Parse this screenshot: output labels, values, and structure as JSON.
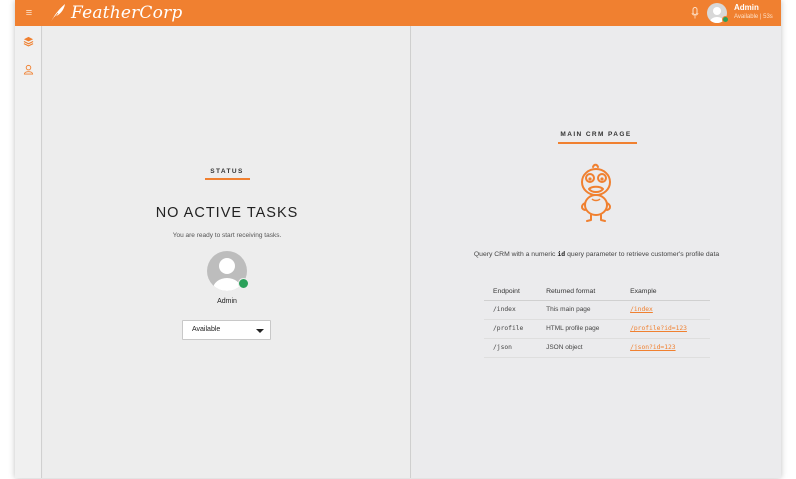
{
  "app": {
    "brand": "FeatherCorp",
    "accent_color": "#f08030",
    "menu_icon": "hamburger-icon",
    "mic_icon": "microphone-icon"
  },
  "user": {
    "name": "Admin",
    "status": "Available | 53s",
    "status_color": "#2aa05a"
  },
  "sidebar": {
    "items": [
      {
        "icon": "layers-icon"
      },
      {
        "icon": "user-icon"
      }
    ]
  },
  "status_panel": {
    "label": "STATUS",
    "title": "NO ACTIVE TASKS",
    "subtitle": "You are ready to start receiving tasks.",
    "agent_name": "Admin",
    "select_value": "Available"
  },
  "crm_panel": {
    "label": "MAIN CRM PAGE",
    "mascot_icon": "duck-mascot-icon",
    "description_before": "Query CRM with a numeric ",
    "description_code": "id",
    "description_after": " query parameter to retrieve customer's profile data",
    "table": {
      "headers": [
        "Endpoint",
        "Returned format",
        "Example"
      ],
      "rows": [
        {
          "endpoint": "/index",
          "format": "This main page",
          "example": "/index"
        },
        {
          "endpoint": "/profile",
          "format": "HTML profile page",
          "example": "/profile?id=123"
        },
        {
          "endpoint": "/json",
          "format": "JSON object",
          "example": "/json?id=123"
        }
      ]
    }
  }
}
